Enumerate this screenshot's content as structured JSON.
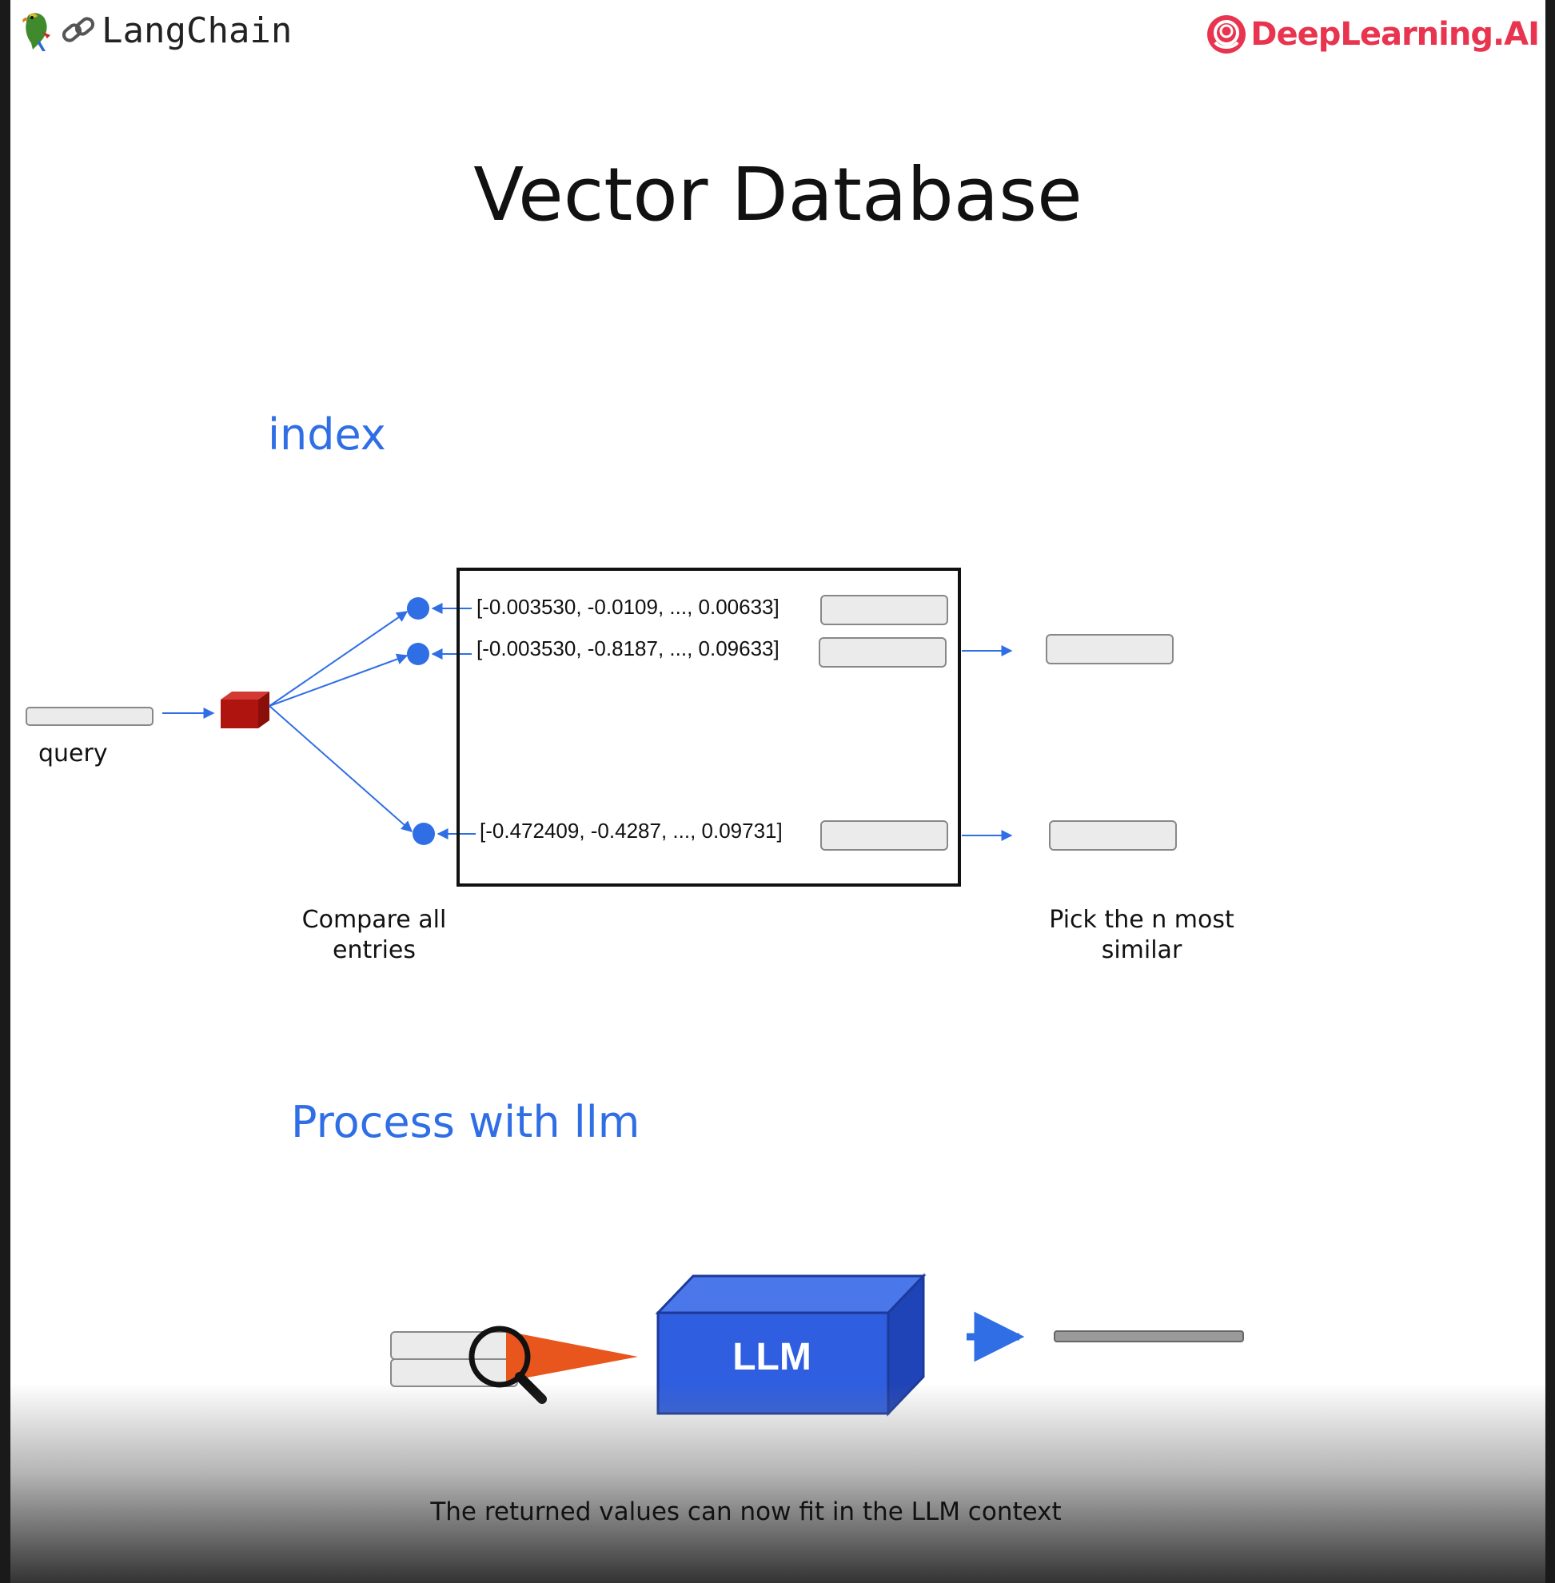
{
  "header": {
    "left_brand": "LangChain",
    "right_brand": "DeepLearning.AI"
  },
  "title": "Vector Database",
  "index_section": {
    "label": "index",
    "query_label": "query",
    "vectors": [
      "[-0.003530, -0.0109, ..., 0.00633]",
      "[-0.003530, -0.8187, ..., 0.09633]",
      "[-0.472409, -0.4287, ..., 0.09731]"
    ],
    "compare_caption": "Compare all entries",
    "pick_caption": "Pick the n most similar"
  },
  "llm_section": {
    "label": "Process with llm",
    "llm_box_label": "LLM",
    "footer_caption": "The returned values can now fit in the LLM context"
  },
  "colors": {
    "accent_blue": "#2f6ee5",
    "embedding_red": "#b0140f",
    "llm_blue": "#2f5ee0",
    "focus_orange": "#e8561e",
    "brand_red": "#e8344e"
  },
  "icons": [
    "parrot-icon",
    "link-icon",
    "deeplearning-logo-icon",
    "magnifier-icon"
  ]
}
